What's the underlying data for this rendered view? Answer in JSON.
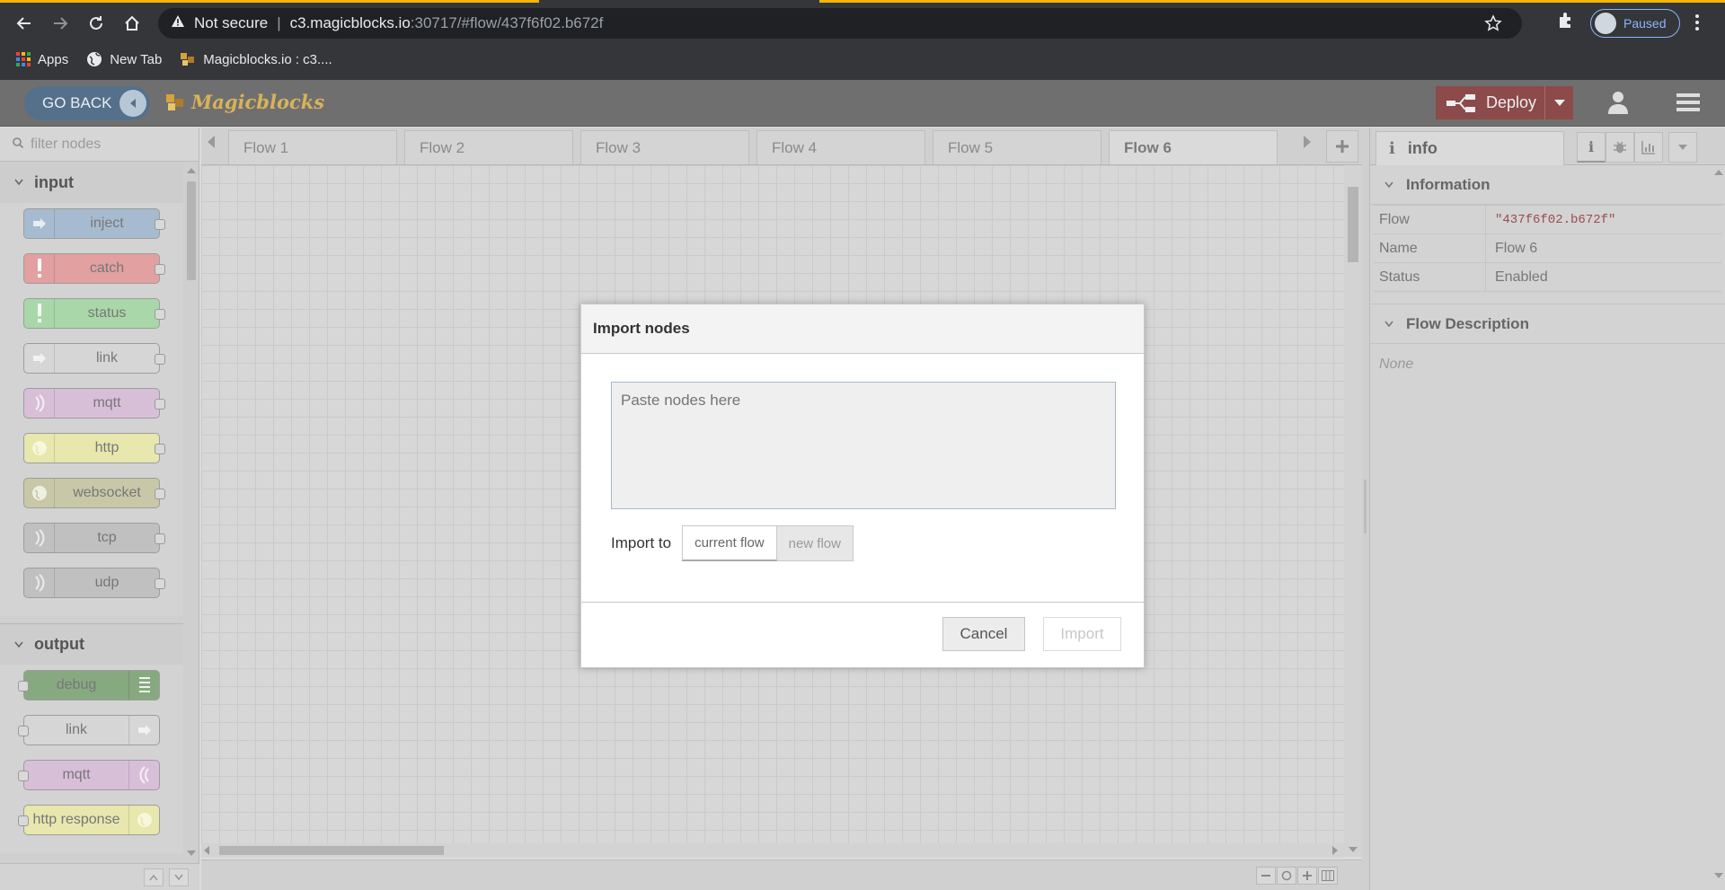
{
  "browser": {
    "security_label": "Not secure",
    "url_host": "c3.magicblocks.io",
    "url_rest": ":30717/#flow/437f6f02.b672f",
    "profile_label": "Paused",
    "bookmarks": [
      {
        "label": "Apps",
        "icon": "apps-grid-icon"
      },
      {
        "label": "New Tab",
        "icon": "globe-icon"
      },
      {
        "label": "Magicblocks.io : c3....",
        "icon": "magicblocks-favicon"
      }
    ],
    "accent_color": "#f4b400"
  },
  "header": {
    "go_back_label": "GO BACK",
    "logo_text": "Magicblocks",
    "deploy_label": "Deploy",
    "deploy_color": "#8c4a4a"
  },
  "palette": {
    "filter_placeholder": "filter nodes",
    "categories": [
      {
        "name": "input",
        "nodes": [
          {
            "label": "inject",
            "color": "#a6bbcf"
          },
          {
            "label": "catch",
            "color": "#e2a0a0"
          },
          {
            "label": "status",
            "color": "#a9d7a9"
          },
          {
            "label": "link",
            "color": "#d6d6d6"
          },
          {
            "label": "mqtt",
            "color": "#d8bfd8"
          },
          {
            "label": "http",
            "color": "#e7e7ae"
          },
          {
            "label": "websocket",
            "color": "#c8c8a8"
          },
          {
            "label": "tcp",
            "color": "#c0c0c0"
          },
          {
            "label": "udp",
            "color": "#c0c0c0"
          }
        ]
      },
      {
        "name": "output",
        "nodes": [
          {
            "label": "debug",
            "color": "#87a980"
          },
          {
            "label": "link",
            "color": "#d6d6d6"
          },
          {
            "label": "mqtt",
            "color": "#d8bfd8"
          },
          {
            "label": "http response",
            "color": "#e7e7ae"
          }
        ]
      }
    ]
  },
  "workspace": {
    "tabs": [
      "Flow 1",
      "Flow 2",
      "Flow 3",
      "Flow 4",
      "Flow 5",
      "Flow 6"
    ],
    "active_tab": "Flow 6"
  },
  "sidebar": {
    "tab_label": "info",
    "information_title": "Information",
    "properties": [
      {
        "key": "Flow",
        "value": "\"437f6f02.b672f\""
      },
      {
        "key": "Name",
        "value": "Flow 6"
      },
      {
        "key": "Status",
        "value": "Enabled"
      }
    ],
    "description_title": "Flow Description",
    "description_value": "None"
  },
  "modal": {
    "title": "Import nodes",
    "textarea_placeholder": "Paste nodes here",
    "import_to_label": "Import to",
    "options": [
      "current flow",
      "new flow"
    ],
    "selected_option": "current flow",
    "cancel_label": "Cancel",
    "import_label": "Import"
  }
}
